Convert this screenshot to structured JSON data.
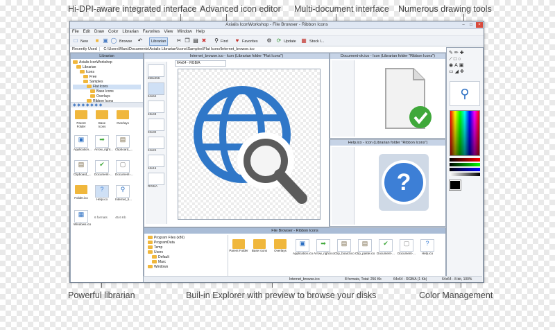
{
  "callouts": {
    "hidpi": "Hi-DPI-aware integrated interface",
    "editor": "Advanced icon editor",
    "multidoc": "Multi-document interface",
    "drawing": "Numerous drawing tools",
    "librarian": "Powerful librarian",
    "explorer": "Buil-in Explorer with preview to browse your disks",
    "color": "Color Management"
  },
  "app": {
    "title": "Axialis IconWorkshop - File Browser - Ribbon Icons",
    "menu": [
      "File",
      "Edit",
      "Draw",
      "Color",
      "Librarian",
      "Favorites",
      "View",
      "Window",
      "Help"
    ],
    "toolbar": {
      "new": "New",
      "browse": "Browse",
      "librarian": "Librarian",
      "find": "Find",
      "favorites": "Favorites",
      "update": "Update",
      "stock": "Stock I..."
    },
    "recently_used": "Recently Used",
    "path": "C:\\Users\\Marc\\Documents\\Axialis Librarian\\Icons\\Samples\\Flat Icons\\Internet_browse.ico"
  },
  "librarian": {
    "title": "Librarian",
    "tree": [
      "Axialis IconWorkshop",
      "Librarian",
      "Icons",
      "Free",
      "Samples",
      "Flat Icons",
      "Base Icons",
      "Overlays",
      "Ribbon Icons"
    ],
    "tiles": [
      {
        "label": "Parent Folder"
      },
      {
        "label": "Base Icons"
      },
      {
        "label": "Overlays"
      },
      {
        "label": "Application..."
      },
      {
        "label": "Arrow_right..."
      },
      {
        "label": "Clipboard_..."
      },
      {
        "label": "Clipboard_..."
      },
      {
        "label": "Document-..."
      },
      {
        "label": "Document-..."
      },
      {
        "label": "Folder.ico"
      },
      {
        "label": "Help.ico"
      },
      {
        "label": "Internet_b..."
      },
      {
        "label": "Windows.ico"
      }
    ],
    "formats": "6 formats",
    "size": "45.6 Kb"
  },
  "editor": {
    "title": "Internet_browse.ico - Icon (Librarian folder \"Flat Icons\")",
    "format": "64x64 - RGB/A",
    "formats": [
      "256x256",
      "64x64",
      "48x48",
      "32x32",
      "24x24",
      "16x16",
      "RGB/A"
    ]
  },
  "doc1": {
    "title": "Document-ok.ico - Icon (Librarian folder \"Ribbon Icons\")"
  },
  "doc2": {
    "title": "Help.ico - Icon (Librarian folder \"Ribbon Icons\")"
  },
  "explorer": {
    "title": "File Browser - Ribbon Icons",
    "tree": [
      "Program Files (x86)",
      "ProgramData",
      "Temp",
      "Users",
      "Default",
      "Marc",
      "Windows"
    ],
    "tiles": [
      "Parent Folder",
      "Base Icons",
      "Overlays",
      "Application.ico",
      "Arrow_right.ico",
      "Clip_board.ico",
      "Clip_paste.ico",
      "Document-...",
      "Document-...",
      "Help.ico"
    ],
    "status": [
      "Internet_browse.ico",
      "8 formats, Total: 256 Kb",
      "64x64 - RGB/A (1 Kb)",
      "64x64 - 8-bit, 100%"
    ]
  },
  "colors": {
    "accent": "#2a6ec2",
    "callout_line": "#6a6a6a",
    "folder": "#f0b73c",
    "ok": "#3fa83a",
    "help": "#3d7fd6"
  }
}
